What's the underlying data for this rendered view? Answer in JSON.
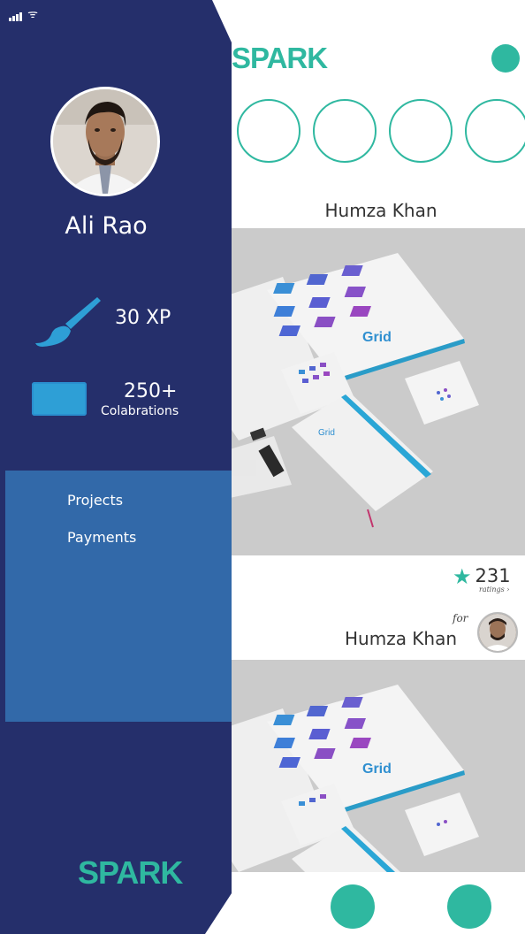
{
  "status_bar": {
    "signal_icon": "signal-bars-icon",
    "wifi_icon": "wifi-icon",
    "wifi_glyph": "ᯤ"
  },
  "feed": {
    "brand": "SPARK",
    "first_card": {
      "author": "Humza Khan"
    },
    "rating": {
      "star_icon": "star-icon",
      "star_glyph": "★",
      "value": "231",
      "sub_label": "ratings ›"
    },
    "client": {
      "for_label": "for",
      "name": "Humza Khan"
    },
    "grid_brand": "Grid",
    "accent_color": "#2fb8a0"
  },
  "drawer": {
    "user_name": "Ali Rao",
    "xp": "30 XP",
    "collaborations_count": "250+",
    "collaborations_label": "Colabrations",
    "menu": [
      {
        "label": "Projects"
      },
      {
        "label": "Payments"
      }
    ],
    "brand": "SPARK",
    "background_color": "#252f6b",
    "menu_panel_color": "#3269a9"
  }
}
